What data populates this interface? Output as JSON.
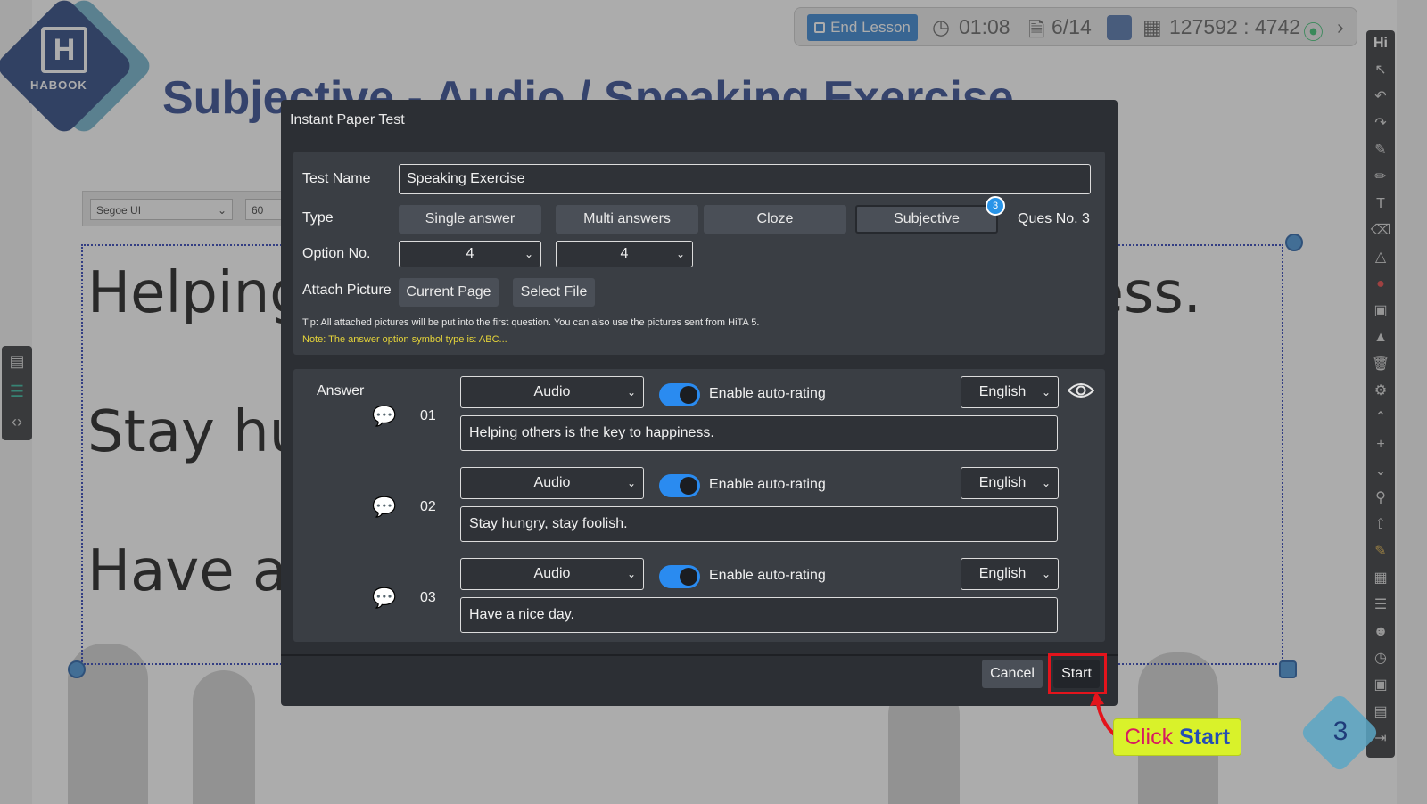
{
  "slide": {
    "logo_text": "HABOOK",
    "title": "Subjective - Audio / Speaking Exercise",
    "font_name": "Segoe UI",
    "font_size": "60",
    "lines": [
      "Helping others is the key to happiness.",
      "Stay hungry, stay foolish.",
      "Have a nice day."
    ],
    "page_number": "3"
  },
  "topbar": {
    "end_lesson": "End Lesson",
    "timer": "01:08",
    "pages": "6/14",
    "session": "127592 : 4742"
  },
  "right_toolbar": {
    "header": "Hi"
  },
  "dialog": {
    "title": "Instant Paper Test",
    "test_name_label": "Test Name",
    "test_name_value": "Speaking Exercise",
    "type_label": "Type",
    "types": [
      "Single answer",
      "Multi answers",
      "Cloze",
      "Subjective"
    ],
    "subjective_count": "3",
    "ques_no": "Ques No. 3",
    "option_no_label": "Option No.",
    "option_no_values": [
      "4",
      "4"
    ],
    "attach_label": "Attach Picture",
    "attach_current": "Current Page",
    "attach_select": "Select File",
    "tip": "Tip: All attached pictures will be put into the first question. You can also use the pictures sent from HiTA 5.",
    "note": "Note: The answer option symbol type is: ABC...",
    "answer_label": "Answer",
    "answers": [
      {
        "num": "01",
        "mode": "Audio",
        "toggle_label": "Enable auto-rating",
        "language": "English",
        "text": "Helping others is the key to happiness."
      },
      {
        "num": "02",
        "mode": "Audio",
        "toggle_label": "Enable auto-rating",
        "language": "English",
        "text": "Stay hungry, stay foolish."
      },
      {
        "num": "03",
        "mode": "Audio",
        "toggle_label": "Enable auto-rating",
        "language": "English",
        "text": "Have a nice day."
      }
    ],
    "cancel": "Cancel",
    "start": "Start"
  },
  "callout": {
    "prefix": "Click ",
    "emphasis": "Start"
  },
  "colors": {
    "dialog_bg": "#2c2f34",
    "panel_bg": "#3a3e44",
    "toggle_on": "#2a8bf0",
    "highlight": "#e4141c",
    "callout_bg": "#d9f22a",
    "accent_blue": "#2d7fd0"
  },
  "icons": [
    "clock-icon",
    "document-icon",
    "speech-bubble-icon",
    "eye-icon",
    "chevron-down-icon",
    "signal-icon"
  ]
}
